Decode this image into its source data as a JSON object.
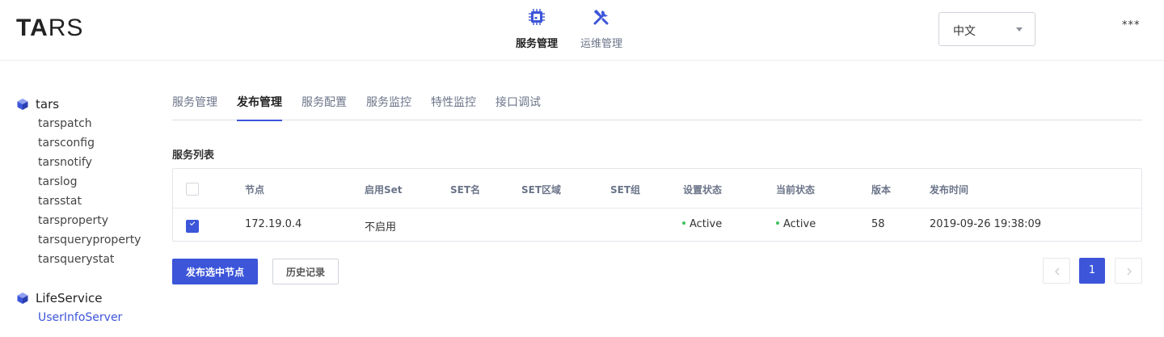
{
  "header": {
    "logo_ta": "TA",
    "logo_rs": "RS",
    "nav": [
      {
        "label": "服务管理",
        "icon": "chip-icon",
        "active": true
      },
      {
        "label": "运维管理",
        "icon": "wrench-screwdriver-icon",
        "active": false
      }
    ],
    "language": {
      "value": "中文"
    },
    "user_menu": "***"
  },
  "sidebar": {
    "apps": [
      {
        "name": "tars",
        "icon": "cube-icon",
        "servers": [
          "tarspatch",
          "tarsconfig",
          "tarsnotify",
          "tarslog",
          "tarsstat",
          "tarsproperty",
          "tarsqueryproperty",
          "tarsquerystat"
        ]
      },
      {
        "name": "LifeService",
        "icon": "cube-icon",
        "servers": [
          "UserInfoServer"
        ],
        "selected_server": "UserInfoServer"
      }
    ]
  },
  "tabs": [
    {
      "label": "服务管理",
      "active": false
    },
    {
      "label": "发布管理",
      "active": true
    },
    {
      "label": "服务配置",
      "active": false
    },
    {
      "label": "服务监控",
      "active": false
    },
    {
      "label": "特性监控",
      "active": false
    },
    {
      "label": "接口调试",
      "active": false
    }
  ],
  "section_title": "服务列表",
  "table": {
    "columns": [
      "节点",
      "启用Set",
      "SET名",
      "SET区域",
      "SET组",
      "设置状态",
      "当前状态",
      "版本",
      "发布时间"
    ],
    "rows": [
      {
        "checked": true,
        "node": "172.19.0.4",
        "enable_set": "不启用",
        "set_name": "",
        "set_area": "",
        "set_group": "",
        "setting_state": "Active",
        "present_state": "Active",
        "version": "58",
        "publish_time": "2019-09-26 19:38:09"
      }
    ]
  },
  "actions": {
    "publish_label": "发布选中节点",
    "history_label": "历史记录"
  },
  "pagination": {
    "current_page": "1"
  },
  "colors": {
    "accent": "#3c55d9",
    "active_status": "#3ec15f"
  }
}
